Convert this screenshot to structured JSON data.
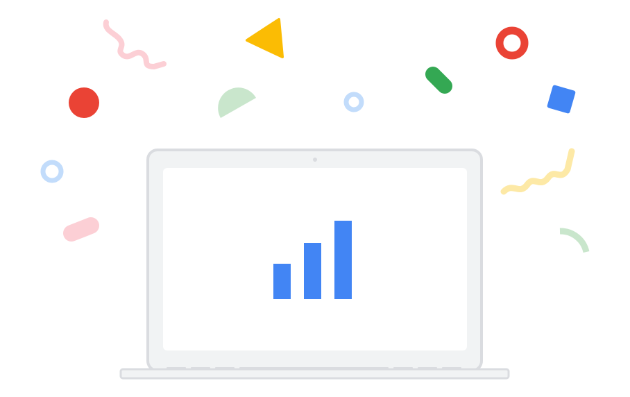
{
  "illustration": {
    "subject": "laptop-with-bar-chart-and-confetti",
    "colors": {
      "background": "#ffffff",
      "laptop_body": "#dadce0",
      "laptop_screen_bezel": "#f1f3f4",
      "laptop_screen": "#ffffff",
      "bars": "#4285f4",
      "red": "#ea4335",
      "yellow": "#fbbc04",
      "green": "#34a853",
      "blue": "#4285f4",
      "light_blue": "#c2dcfb",
      "light_pink": "#fccfd5",
      "light_green": "#c9e6cc",
      "light_yellow": "#fde9a6"
    },
    "chart": {
      "bar_count": 3,
      "relative_values": [
        0.45,
        0.72,
        1.0
      ]
    },
    "confetti": [
      "pink-squiggle-shape",
      "yellow-triangle-shape",
      "red-ring-shape",
      "red-circle-shape",
      "green-half-circle-shape",
      "blue-ring-shape",
      "green-pill-shape",
      "blue-square-shape",
      "light-blue-ring-shape",
      "pink-pill-shape",
      "yellow-squiggle-shape",
      "green-arc-shape"
    ]
  }
}
